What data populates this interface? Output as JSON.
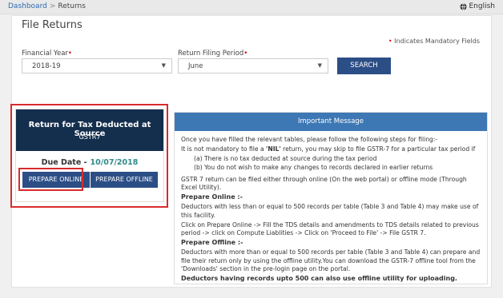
{
  "breadcrumb": {
    "home": "Dashboard",
    "separator": ">",
    "current": "Returns"
  },
  "language": {
    "label": "English",
    "icon": "globe-icon"
  },
  "page": {
    "title": "File Returns",
    "mandatory_note": "Indicates Mandatory Fields",
    "required_mark": "•"
  },
  "form": {
    "financial_year": {
      "label": "Financial Year",
      "value": "2018-19"
    },
    "period": {
      "label": "Return Filing Period",
      "value": "June"
    },
    "search_label": "SEARCH"
  },
  "tile": {
    "title": "Return for Tax Deducted at Source",
    "subtitle": "GSTR7",
    "due_label": "Due Date -",
    "due_value": "10/07/2018",
    "prepare_online": "PREPARE ONLINE",
    "prepare_offline": "PREPARE OFFLINE"
  },
  "message": {
    "header": "Important Message",
    "intro": "Once you have filled the relevant tables, please follow the following steps for filing:-",
    "nil_pre": "It is not mandatory to file a ",
    "nil_word": "'NIL'",
    "nil_post": " return, you may skip to file GSTR-7 for a particular tax period if",
    "cond_a": "(a) There is no tax deducted at source during the tax period",
    "cond_b": "(b) You do not wish to make any changes to records declared in earlier returns",
    "modes": "GSTR 7 return can be filed either through online (On the web portal) or offline mode (Through Excel Utility).",
    "online_heading": "Prepare Online :-",
    "online_p1": "Deductors with less than or equal to 500 records per table (Table 3 and Table 4) may make use of this facility.",
    "online_p2": "Click on Prepare Online -> Fill the TDS details and amendments to TDS details related to previous period -> click on Compute Liablities -> Click on 'Proceed to File' -> File GSTR 7.",
    "offline_heading": "Prepare Offline :-",
    "offline_p1": "Deductors with more than or equal to 500 records per table (Table 3 and Table 4) can prepare and file their return only by using the offline utility.You can download the GSTR-7 offline tool from the 'Downloads' section in the pre-login page on the portal.",
    "final": "Deductors having records upto 500 can also use offline utility for uploading."
  },
  "colors": {
    "navy": "#142e4d",
    "button": "#2c4e86",
    "info_header": "#3d78b5",
    "highlight": "#d92b2b",
    "date": "#2f8a8a"
  }
}
